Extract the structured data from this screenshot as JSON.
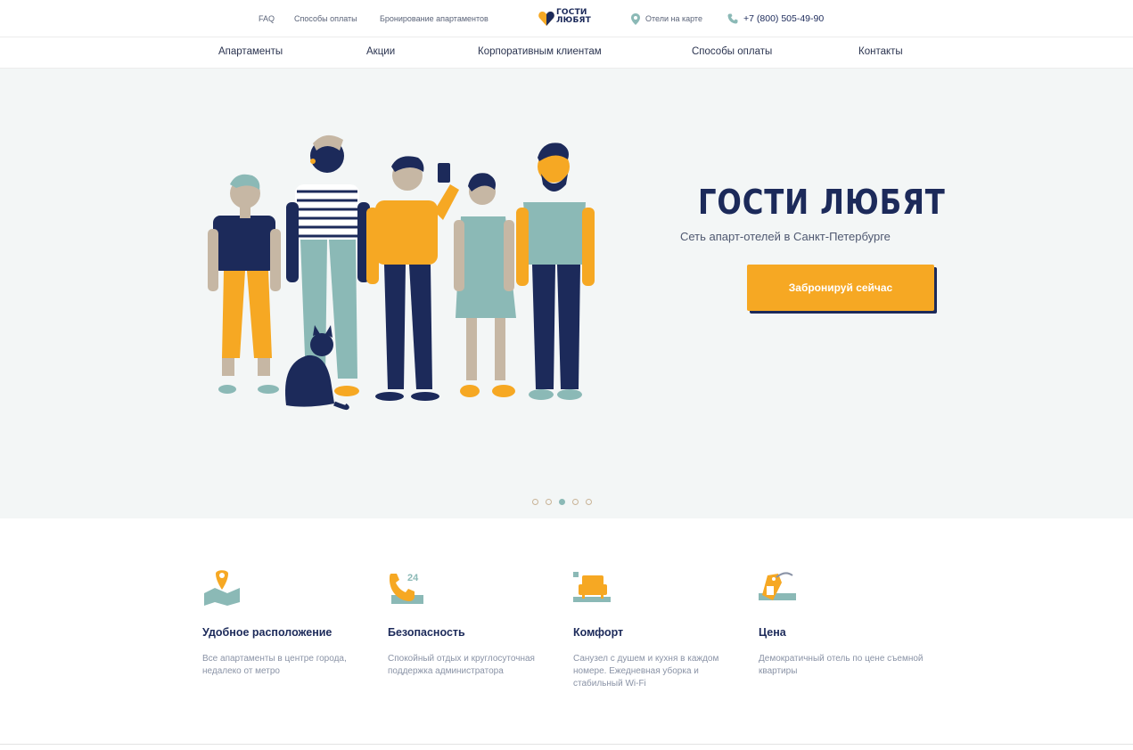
{
  "topbar": {
    "links": [
      "FAQ",
      "Способы оплаты",
      "Бронирование апартаментов"
    ],
    "logo_line1": "ГОСТИ",
    "logo_line2": "ЛЮБЯТ",
    "map_link": "Отели на карте",
    "phone": "+7 (800) 505-49-90"
  },
  "nav": {
    "items": [
      "Апартаменты",
      "Акции",
      "Корпоративным клиентам",
      "Способы оплаты",
      "Контакты"
    ]
  },
  "hero": {
    "title": "ГОСТИ ЛЮБЯТ",
    "subtitle": "Сеть апарт-отелей в Санкт-Петербурге",
    "cta_label": "Забронируй сейчас",
    "slides_count": 5,
    "active_slide": 3
  },
  "features": [
    {
      "icon": "location-pin-icon",
      "title": "Удобное расположение",
      "text": "Все апартаменты в центре города, недалеко от метро"
    },
    {
      "icon": "phone-24-icon",
      "title": "Безопасность",
      "text": "Спокойный отдых и круглосуточная поддержка администратора"
    },
    {
      "icon": "sofa-icon",
      "title": "Комфорт",
      "text": "Санузел с душем и кухня в каждом номере. Ежедневная уборка и стабильный Wi-Fi"
    },
    {
      "icon": "price-tag-icon",
      "title": "Цена",
      "text": "Демократичный отель по цене съемной квартиры"
    }
  ],
  "colors": {
    "navy": "#1c2a5a",
    "accent": "#f6a823",
    "teal": "#8bb9b6",
    "hero_bg": "#f3f6f6"
  }
}
